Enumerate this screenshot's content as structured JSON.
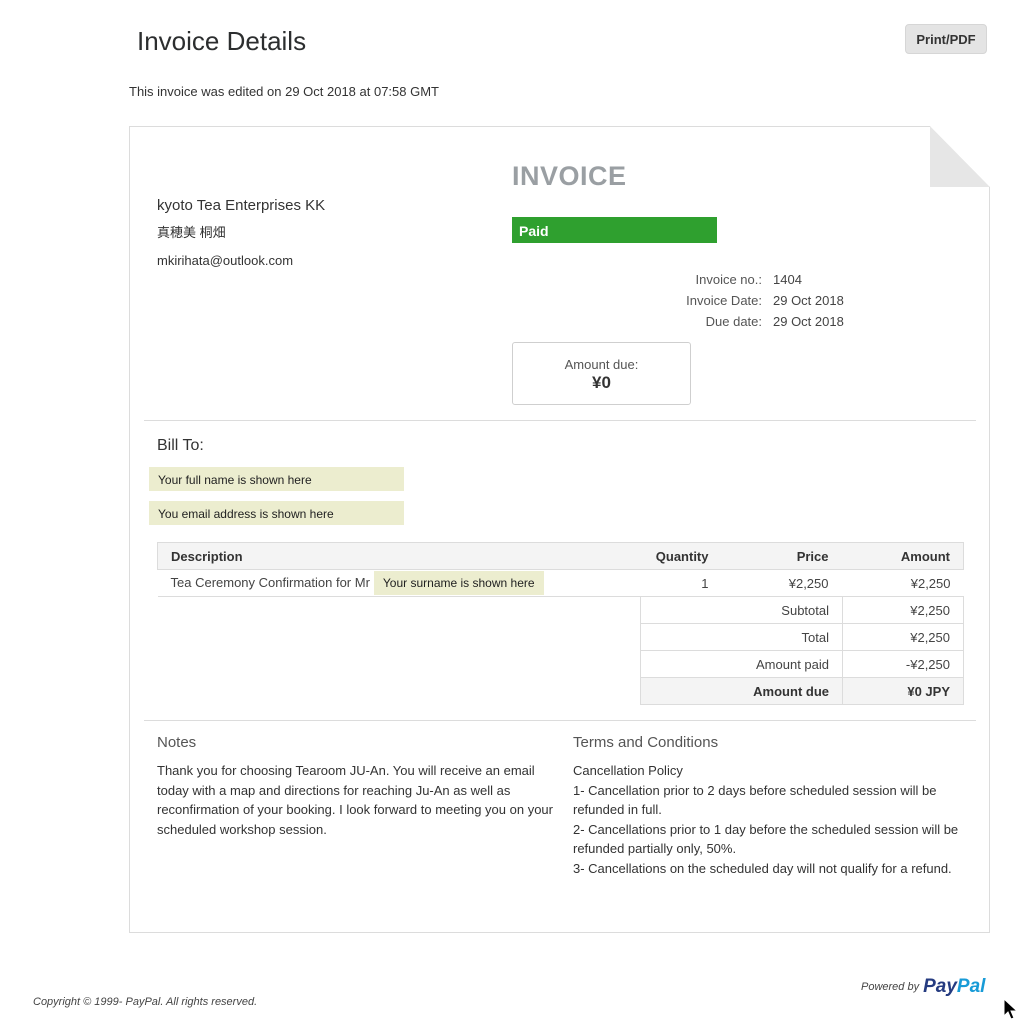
{
  "header": {
    "title": "Invoice Details",
    "print_label": "Print/PDF",
    "edited_note": "This invoice was edited on 29 Oct 2018 at 07:58 GMT"
  },
  "invoice": {
    "heading": "INVOICE",
    "status": "Paid",
    "merchant": {
      "name": "kyoto Tea Enterprises KK",
      "person": "真穂美 桐畑",
      "email": "mkirihata@outlook.com"
    },
    "meta": [
      {
        "label": "Invoice no.:",
        "value": "1404"
      },
      {
        "label": "Invoice Date:",
        "value": "29 Oct 2018"
      },
      {
        "label": "Due date:",
        "value": "29 Oct 2018"
      }
    ],
    "amount_due_label": "Amount due:",
    "amount_due_value": "¥0",
    "bill_to": {
      "title": "Bill To:",
      "name_placeholder": "Your full name is shown here",
      "email_placeholder": "You email address is shown here"
    },
    "items_header": {
      "description": "Description",
      "quantity": "Quantity",
      "price": "Price",
      "amount": "Amount"
    },
    "items": [
      {
        "description": "Tea Ceremony Confirmation for Mr",
        "surname_placeholder": "Your surname is shown here",
        "quantity": "1",
        "price": "¥2,250",
        "amount": "¥2,250"
      }
    ],
    "totals": [
      {
        "label": "Subtotal",
        "value": "¥2,250"
      },
      {
        "label": "Total",
        "value": "¥2,250"
      },
      {
        "label": "Amount paid",
        "value": "-¥2,250"
      },
      {
        "label": "Amount due",
        "value": "¥0 JPY"
      }
    ],
    "notes": {
      "title": "Notes",
      "text": "Thank you for choosing Tearoom JU-An. You will receive an email today with a map and directions for reaching Ju-An as well as reconfirmation of your booking. I look forward to meeting you on your scheduled workshop session."
    },
    "terms": {
      "title": "Terms and Conditions",
      "lines": [
        "Cancellation Policy",
        "1- Cancellation prior to 2 days before scheduled session will be refunded in full.",
        "2- Cancellations prior to 1 day before the scheduled session will be refunded partially only, 50%.",
        "3- Cancellations on the scheduled day will not qualify for a refund."
      ]
    }
  },
  "footer": {
    "copyright": "Copyright © 1999- PayPal. All rights reserved.",
    "powered_by": "Powered by",
    "logo_part1": "Pay",
    "logo_part2": "Pal"
  },
  "colors": {
    "paid_badge": "#2fa02f",
    "highlight": "#ecedcf",
    "paypal_dark": "#253b80",
    "paypal_light": "#179bd7"
  }
}
